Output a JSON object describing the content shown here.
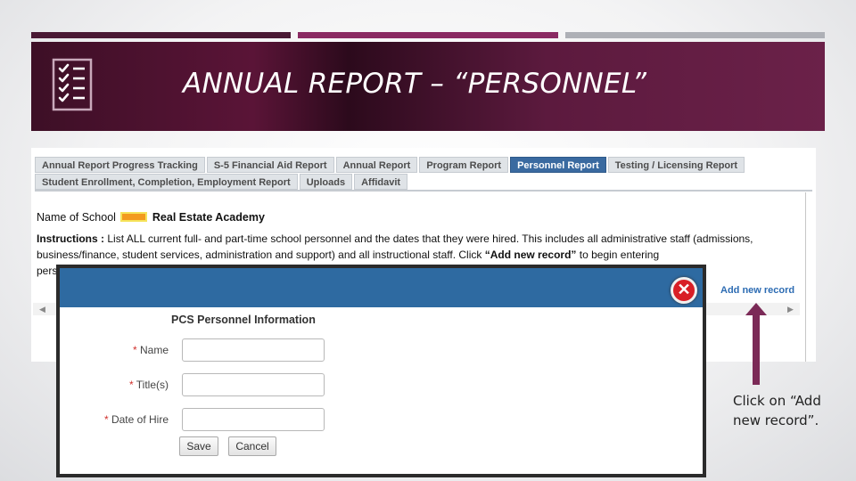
{
  "slide": {
    "title": "ANNUAL REPORT – “PERSONNEL”",
    "callout": "Click on “Add new record”.",
    "colors": {
      "accent": "#5a1437",
      "accent_mid": "#8a2a62",
      "accent_gray": "#aeb0b6",
      "arrow": "#7b2a57"
    }
  },
  "app": {
    "tabs_row1": [
      {
        "label": "Annual Report Progress Tracking"
      },
      {
        "label": "S-5 Financial Aid Report"
      },
      {
        "label": "Annual Report"
      },
      {
        "label": "Program Report"
      },
      {
        "label": "Personnel Report",
        "active": true
      },
      {
        "label": "Testing / Licensing Report"
      }
    ],
    "tabs_row2": [
      {
        "label": "Student Enrollment, Completion, Employment Report"
      },
      {
        "label": "Uploads"
      },
      {
        "label": "Affidavit"
      }
    ],
    "school_label": "Name of School",
    "school_name": "Real Estate Academy",
    "instructions_label": "Instructions :",
    "instructions_text": "List ALL current full- and part-time school personnel and the dates that they were hired. This includes all administrative staff (admissions, business/finance, student services, administration and support) and all instructional staff. Click",
    "instructions_link": "“Add new record”",
    "instructions_tail": "to begin entering",
    "instructions_cut": "pers",
    "add_record_link": "Add new record",
    "colors": {
      "active_tab": "#3a6aa0",
      "link": "#2d6cb3",
      "redaction": "#f39a1e"
    }
  },
  "modal": {
    "title": "PCS Personnel Information",
    "required_marker": "*",
    "fields": [
      {
        "label": "Name",
        "value": ""
      },
      {
        "label": "Title(s)",
        "value": ""
      },
      {
        "label": "Date of Hire",
        "value": ""
      }
    ],
    "save_label": "Save",
    "cancel_label": "Cancel",
    "close_glyph": "✕",
    "colors": {
      "header": "#2e6aa1",
      "close": "#d81f26",
      "required": "#d0312d"
    }
  }
}
